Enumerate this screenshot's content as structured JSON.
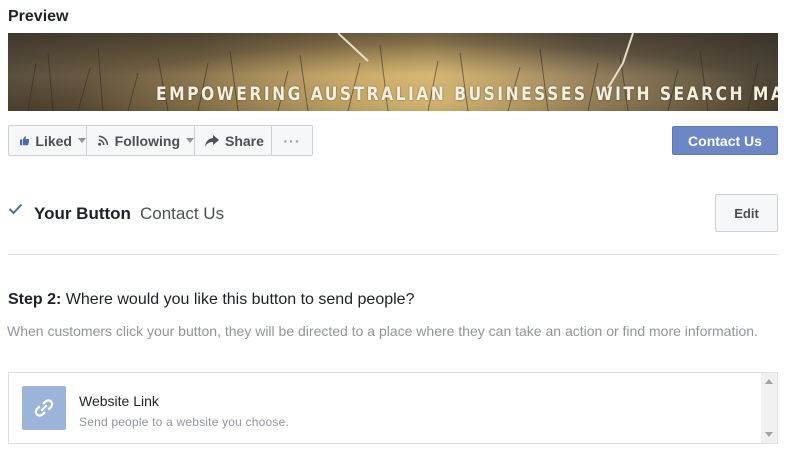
{
  "preview": {
    "title": "Preview"
  },
  "cover": {
    "text": "EMPOWERING AUSTRALIAN BUSINESSES WITH SEARCH MARKET"
  },
  "page_actions": {
    "liked": "Liked",
    "following": "Following",
    "share": "Share",
    "more": "···"
  },
  "cta_button": {
    "label": "Contact Us",
    "color": "#6d87c4"
  },
  "your_button": {
    "label": "Your Button",
    "value": "Contact Us",
    "edit_label": "Edit"
  },
  "step": {
    "number": "Step 2:",
    "question": "Where would you like this button to send people?",
    "description": "When customers click your button, they will be directed to a place where they can take an action or find more information."
  },
  "options": [
    {
      "icon": "link-icon",
      "title": "Website Link",
      "subtitle": "Send people to a website you choose."
    }
  ],
  "colors": {
    "accent": "#6d87c4",
    "icon_box": "#9cb4d8",
    "check": "#4b6ba9"
  }
}
